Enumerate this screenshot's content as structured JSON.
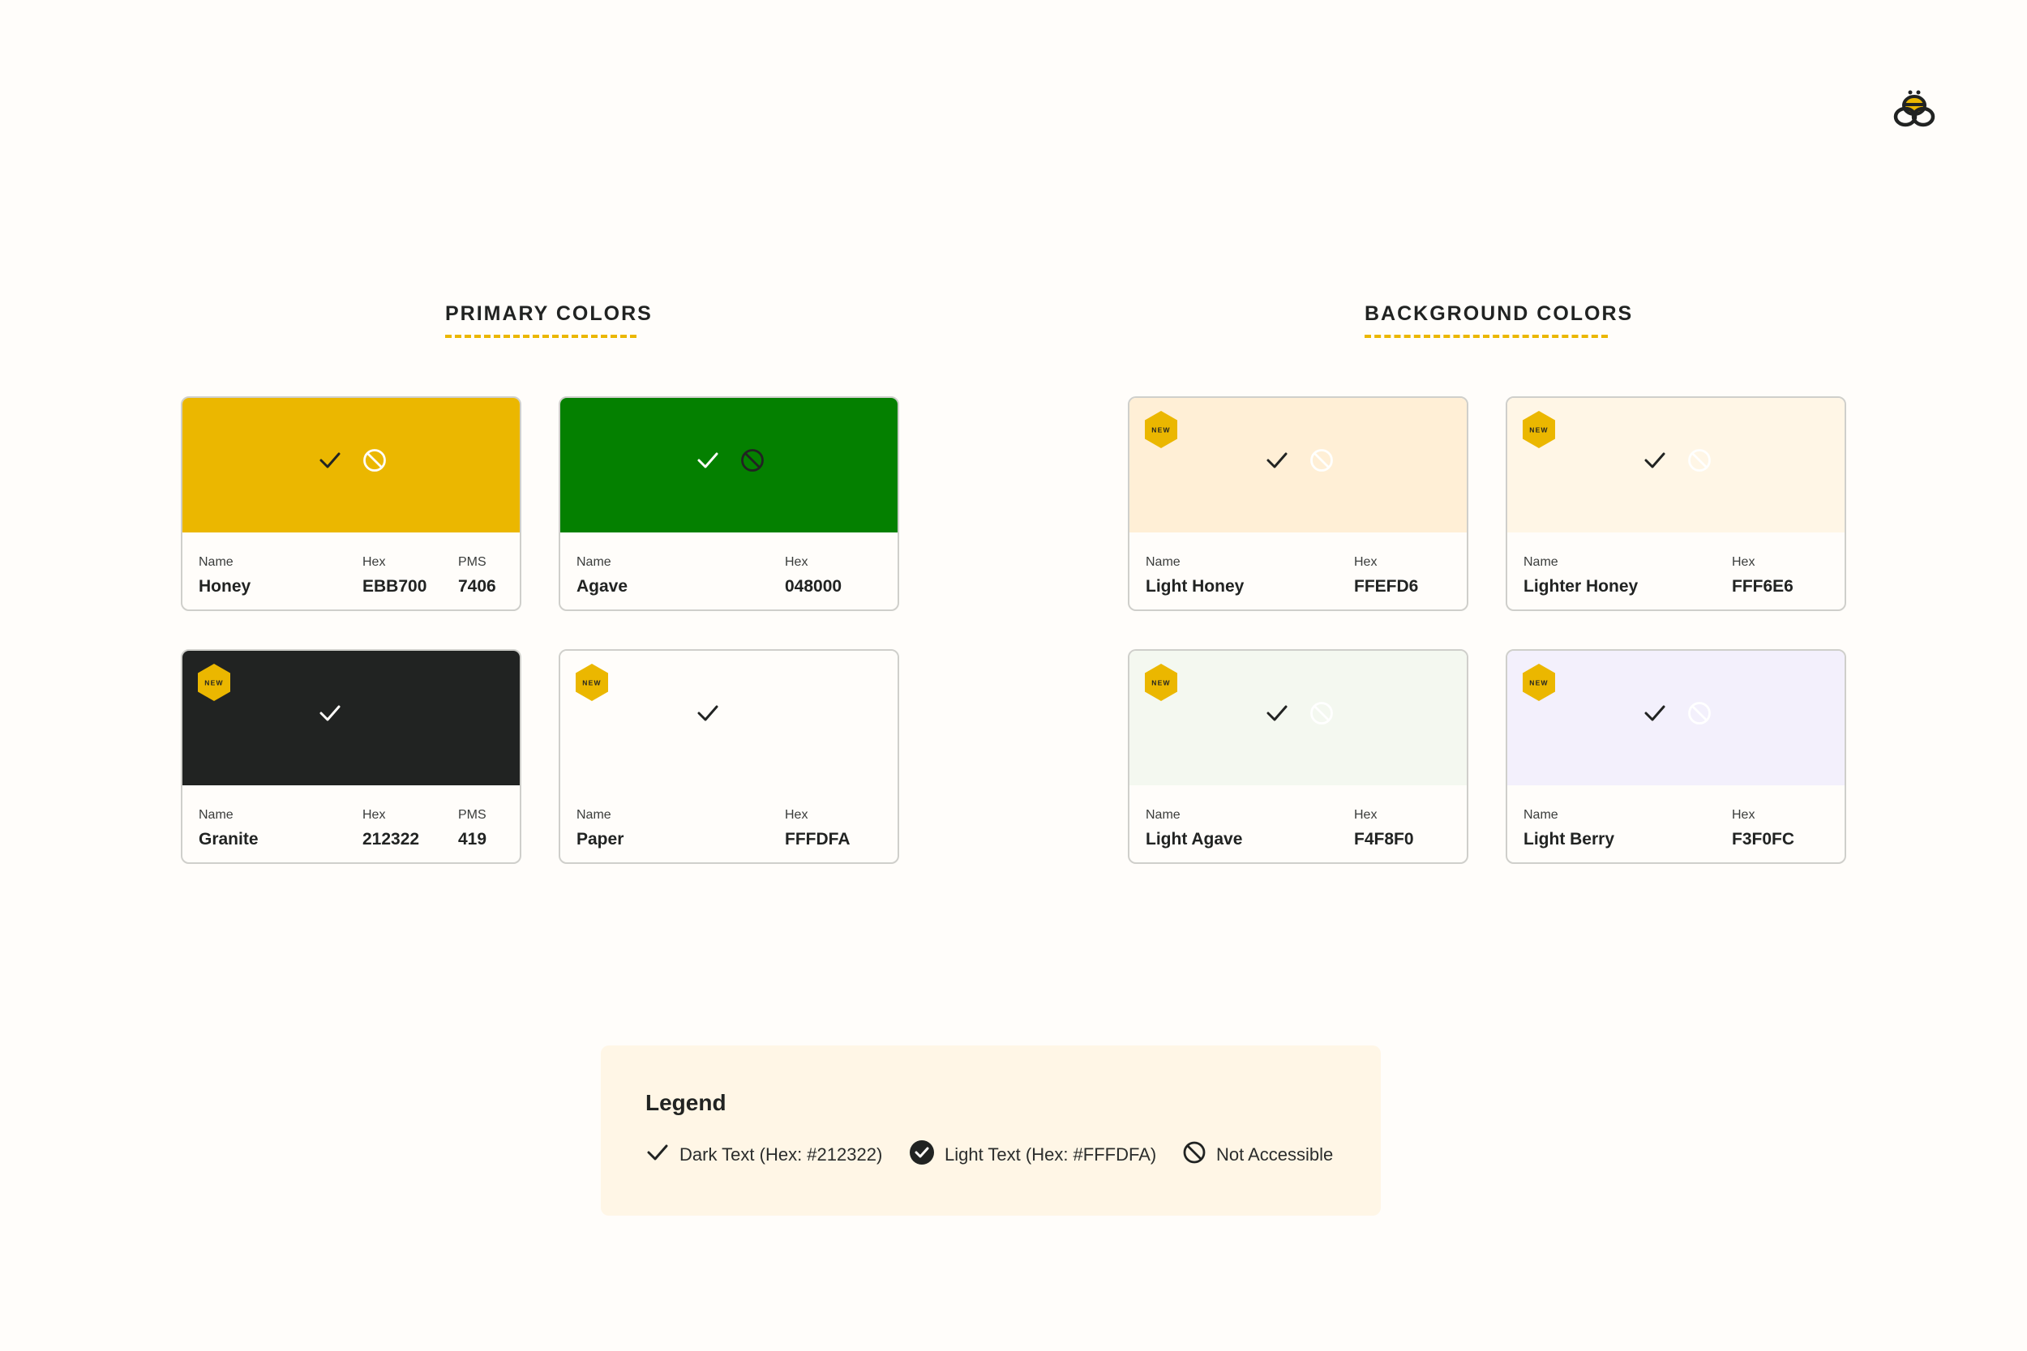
{
  "brand": {
    "accent": "#EBB700",
    "ink": "#212322",
    "paper": "#FFFDFA"
  },
  "logo": {
    "icon": "bee-icon"
  },
  "primary": {
    "title": "PRIMARY COLORS",
    "cards": [
      {
        "name_label": "Name",
        "hex_label": "Hex",
        "pms_label": "PMS",
        "name": "Honey",
        "hex": "EBB700",
        "pms": "7406",
        "swatch": "#EBB700",
        "dark_text": "check",
        "light_text": "not-accessible",
        "new": false
      },
      {
        "name_label": "Name",
        "hex_label": "Hex",
        "name": "Agave",
        "hex": "048000",
        "swatch": "#048000",
        "dark_text": "not-accessible",
        "light_text": "check",
        "new": false
      },
      {
        "name_label": "Name",
        "hex_label": "Hex",
        "pms_label": "PMS",
        "name": "Granite",
        "hex": "212322",
        "pms": "419",
        "swatch": "#212322",
        "dark_text": "none",
        "light_text": "check",
        "new": true,
        "badge": "NEW"
      },
      {
        "name_label": "Name",
        "hex_label": "Hex",
        "name": "Paper",
        "hex": "FFFDFA",
        "swatch": "#FFFDFA",
        "dark_text": "check",
        "light_text": "none",
        "new": true,
        "badge": "NEW"
      }
    ]
  },
  "background": {
    "title": "BACKGROUND COLORS",
    "cards": [
      {
        "name_label": "Name",
        "hex_label": "Hex",
        "name": "Light Honey",
        "hex": "FFEFD6",
        "swatch": "#FFEFD6",
        "dark_text": "check",
        "light_text": "not-accessible",
        "new": true,
        "badge": "NEW"
      },
      {
        "name_label": "Name",
        "hex_label": "Hex",
        "name": "Lighter Honey",
        "hex": "FFF6E6",
        "swatch": "#FFF6E6",
        "dark_text": "check",
        "light_text": "not-accessible",
        "new": true,
        "badge": "NEW"
      },
      {
        "name_label": "Name",
        "hex_label": "Hex",
        "name": "Light Agave",
        "hex": "F4F8F0",
        "swatch": "#F4F8F0",
        "dark_text": "check",
        "light_text": "not-accessible",
        "new": true,
        "badge": "NEW"
      },
      {
        "name_label": "Name",
        "hex_label": "Hex",
        "name": "Light Berry",
        "hex": "F3F0FC",
        "swatch": "#F3F0FC",
        "dark_text": "check",
        "light_text": "not-accessible",
        "new": true,
        "badge": "NEW"
      }
    ]
  },
  "legend": {
    "title": "Legend",
    "items": [
      {
        "icon": "check-icon",
        "label": "Dark Text (Hex: #212322)"
      },
      {
        "icon": "filled-check-icon",
        "label": "Light Text (Hex: #FFFDFA)"
      },
      {
        "icon": "not-accessible-icon",
        "label": "Not Accessible"
      }
    ]
  }
}
